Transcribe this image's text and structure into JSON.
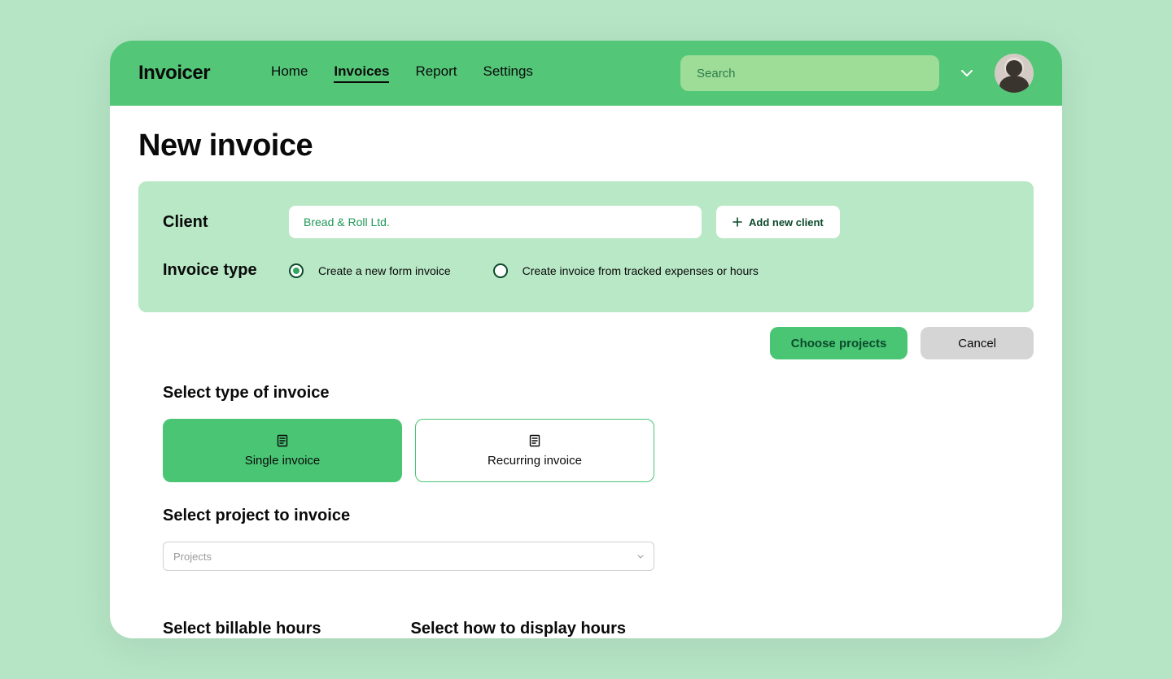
{
  "brand": "Invoicer",
  "nav": {
    "items": [
      {
        "label": "Home",
        "active": false
      },
      {
        "label": "Invoices",
        "active": true
      },
      {
        "label": "Report",
        "active": false
      },
      {
        "label": "Settings",
        "active": false
      }
    ]
  },
  "search": {
    "placeholder": "Search"
  },
  "page": {
    "title": "New invoice"
  },
  "client_panel": {
    "client_label": "Client",
    "client_value": "Bread & Roll Ltd.",
    "add_client_label": "Add new client",
    "invoice_type_label": "Invoice type",
    "radio_options": [
      {
        "label": "Create a new form invoice",
        "selected": true
      },
      {
        "label": "Create invoice from tracked expenses or hours",
        "selected": false
      }
    ]
  },
  "actions": {
    "primary": "Choose projects",
    "secondary": "Cancel"
  },
  "sections": {
    "invoice_type_title": "Select type of invoice",
    "invoice_types": [
      {
        "label": "Single invoice",
        "variant": "filled"
      },
      {
        "label": "Recurring invoice",
        "variant": "outlined"
      }
    ],
    "project_title": "Select project to invoice",
    "project_placeholder": "Projects",
    "billable_title": "Select billable hours",
    "display_title": "Select how to display hours"
  }
}
